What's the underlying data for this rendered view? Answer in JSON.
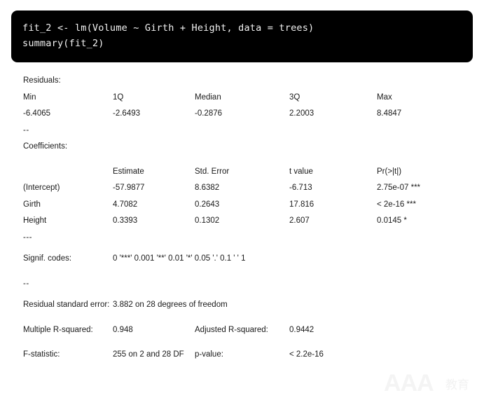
{
  "code_block": {
    "lines": [
      "fit_2 <- lm(Volume ~ Girth + Height, data = trees)",
      "summary(fit_2)"
    ]
  },
  "output": {
    "residuals": {
      "title": "Residuals:",
      "headers": [
        "Min",
        "1Q",
        "Median",
        "3Q",
        "Max"
      ],
      "values": [
        "-6.4065",
        "-2.6493",
        "-0.2876",
        "2.2003",
        "8.4847"
      ]
    },
    "separator_short": "--",
    "separator_long": "---",
    "coefficients": {
      "title": "Coefficients:",
      "headers": [
        "",
        "Estimate",
        "Std. Error",
        "t value",
        "Pr(>|t|)"
      ],
      "rows": [
        {
          "term": "(Intercept)",
          "estimate": "-57.9877",
          "std_error": "8.6382",
          "t_value": "-6.713",
          "p_value": "2.75e-07 ***"
        },
        {
          "term": "Girth",
          "estimate": "4.7082",
          "std_error": "0.2643",
          "t_value": "17.816",
          "p_value": "< 2e-16 ***"
        },
        {
          "term": "Height",
          "estimate": "0.3393",
          "std_error": "0.1302",
          "t_value": "2.607",
          "p_value": "0.0145 *"
        }
      ]
    },
    "signif": {
      "label": "Signif. codes:",
      "value": "0 '***' 0.001 '**' 0.01 '*'  0.05 '.' 0.1 ' ' 1"
    },
    "residual_standard_error": {
      "label": "Residual standard error:",
      "value": "3.882 on 28 degrees of  freedom"
    },
    "r_squared": {
      "label": "Multiple R-squared:",
      "value": "0.948",
      "adj_label": "Adjusted R-squared:",
      "adj_value": "0.9442"
    },
    "f_statistic": {
      "label": "F-statistic:",
      "value": "255 on 2 and 28 DF",
      "p_label": "p-value:",
      "p_value": "< 2.2e-16"
    }
  },
  "watermark": {
    "primary": "AAA",
    "secondary": "教育"
  }
}
